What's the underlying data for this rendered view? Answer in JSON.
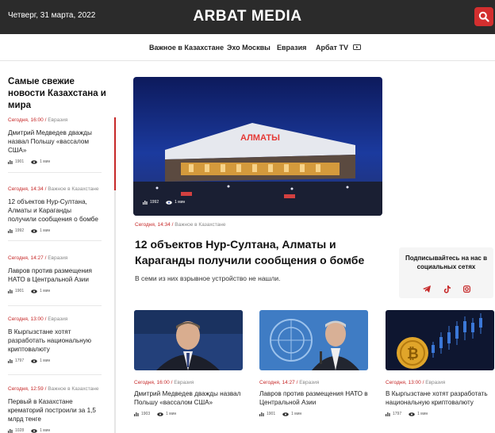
{
  "header": {
    "date": "Четверг, 31 марта, 2022",
    "logo": "ARBAT MEDIA",
    "search_icon": "search-icon"
  },
  "nav": [
    {
      "label": "Важное в Казахстане"
    },
    {
      "label": "Эхо Москвы"
    },
    {
      "label": "Евразия"
    },
    {
      "label": "Арбат TV",
      "icon": "tv-icon"
    }
  ],
  "sidebar": {
    "heading": "Самые свежие новости Казахстана и мира",
    "items": [
      {
        "time": "Сегодня, 16:00",
        "category": "Евразия",
        "title": "Дмитрий Медведев дважды назвал Польшу «вассалом США»",
        "views": "1901",
        "read": "1 мин"
      },
      {
        "time": "Сегодня, 14:34",
        "category": "Важное в Казахстане",
        "title": "12 объектов Нур-Султана, Алматы и Караганды получили сообщения о бомбе",
        "views": "1992",
        "read": "1 мин"
      },
      {
        "time": "Сегодня, 14:27",
        "category": "Евразия",
        "title": "Лавров против размещения НАТО в Центральной Азии",
        "views": "1901",
        "read": "1 мин"
      },
      {
        "time": "Сегодня, 13:00",
        "category": "Евразия",
        "title": "В Кыргызстане хотят разработать национальную криптовалюту",
        "views": "1797",
        "read": "1 мин"
      },
      {
        "time": "Сегодня, 12:59",
        "category": "Важное в Казахстане",
        "title": "Первый в Казахстане крематорий построили за 1,5 млрд тенге",
        "views": "1028",
        "read": "1 мин"
      }
    ]
  },
  "hero": {
    "image_sign": "АЛМАТЫ",
    "views": "1992",
    "read": "1 мин",
    "time": "Сегодня, 14:34",
    "category": "Важное в Казахстане",
    "title": "12 объектов Нур-Султана, Алматы и Караганды получили сообщения о бомбе",
    "lead": "В семи из них взрывное устройство не нашли."
  },
  "social": {
    "label": "Подписывайтесь на нас в социальных сетях",
    "icons": [
      "telegram-icon",
      "tiktok-icon",
      "instagram-icon"
    ],
    "accent": "#c62828"
  },
  "cards": [
    {
      "time": "Сегодня, 16:00",
      "category": "Евразия",
      "title": "Дмитрий Медведев дважды назвал Польшу «вассалом США»",
      "views": "1903",
      "read": "1 мин"
    },
    {
      "time": "Сегодня, 14:27",
      "category": "Евразия",
      "title": "Лавров против размещения НАТО в Центральной Азии",
      "views": "1901",
      "read": "1 мин"
    },
    {
      "time": "Сегодня, 13:00",
      "category": "Евразия",
      "title": "В Кыргызстане хотят разработать национальную криптовалюту",
      "views": "1797",
      "read": "1 мин"
    }
  ]
}
